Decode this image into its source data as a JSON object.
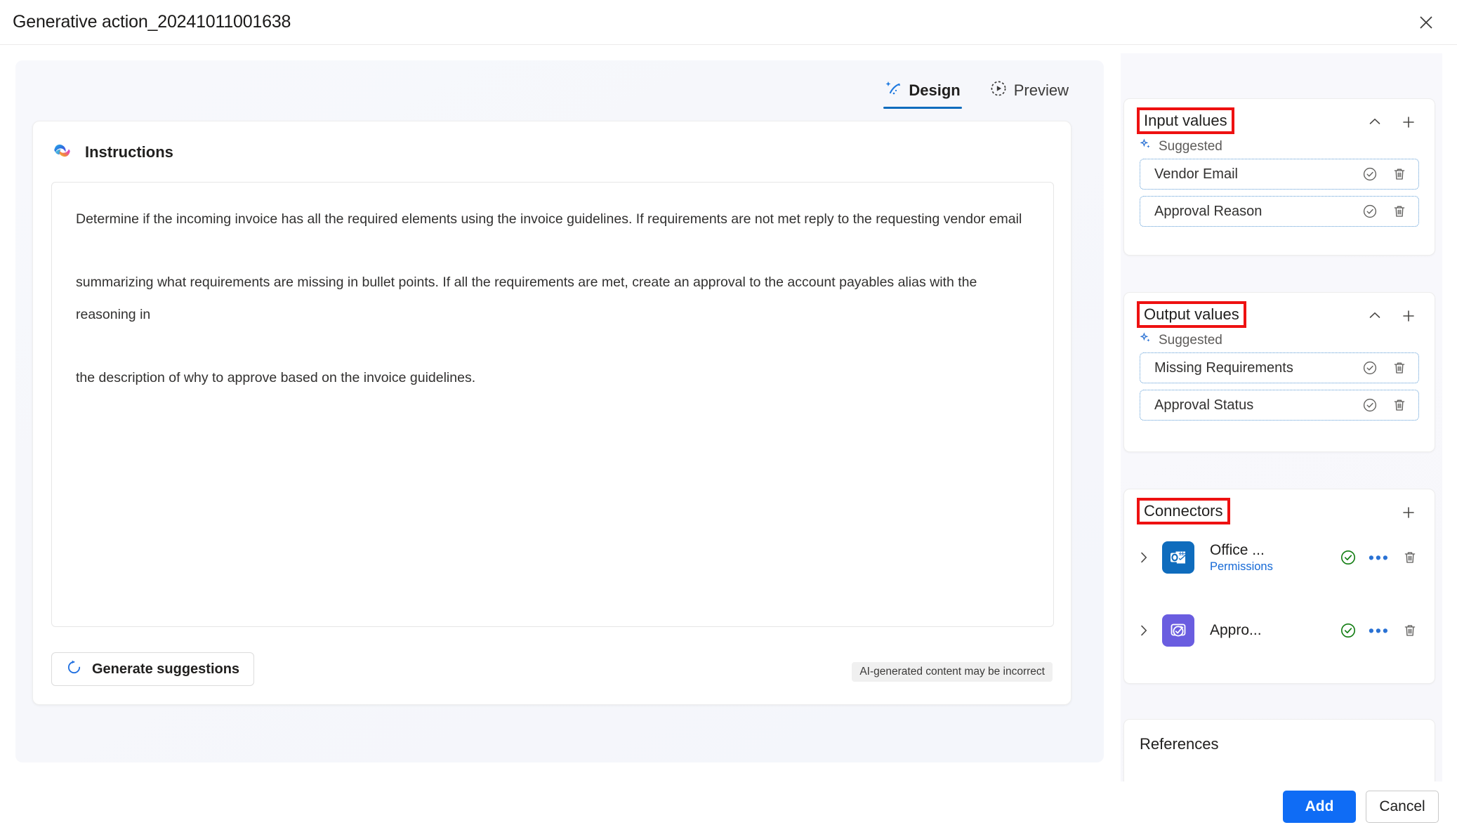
{
  "window": {
    "title": "Generative action_20241011001638",
    "close_icon": "close-icon"
  },
  "tabs": [
    {
      "label": "Design",
      "icon": "sparkle-wand-icon",
      "active": true
    },
    {
      "label": "Preview",
      "icon": "play-circle-dashed-icon",
      "active": false
    }
  ],
  "instructions": {
    "header": "Instructions",
    "header_icon": "copilot-icon",
    "text": "Determine if the incoming invoice has all the required elements using the invoice guidelines. If requirements are not met reply to the requesting vendor email\n\nsummarizing what requirements are missing in bullet points. If all the requirements are met, create an approval to the account payables alias with the reasoning in\n\nthe description of why to approve based on the invoice guidelines.",
    "generate_button": "Generate suggestions",
    "generate_icon": "refresh-circle-icon",
    "ai_disclaimer": "AI-generated content may be incorrect"
  },
  "panels": {
    "input_values": {
      "title": "Input values",
      "annotated": true,
      "collapse_icon": "chevron-up-icon",
      "add_icon": "plus-icon",
      "suggested_label": "Suggested",
      "suggested_icon": "sparkle-icon",
      "items": [
        {
          "name": "Vendor Email",
          "accept_icon": "check-circle-icon",
          "delete_icon": "trash-icon"
        },
        {
          "name": "Approval Reason",
          "accept_icon": "check-circle-icon",
          "delete_icon": "trash-icon"
        }
      ]
    },
    "output_values": {
      "title": "Output values",
      "annotated": true,
      "collapse_icon": "chevron-up-icon",
      "add_icon": "plus-icon",
      "suggested_label": "Suggested",
      "suggested_icon": "sparkle-icon",
      "items": [
        {
          "name": "Missing Requirements",
          "accept_icon": "check-circle-icon",
          "delete_icon": "trash-icon"
        },
        {
          "name": "Approval Status",
          "accept_icon": "check-circle-icon",
          "delete_icon": "trash-icon"
        }
      ]
    },
    "connectors": {
      "title": "Connectors",
      "annotated": true,
      "add_icon": "plus-icon",
      "items": [
        {
          "name": "Office ...",
          "sublabel": "Permissions",
          "icon": "outlook-icon",
          "status_icon": "check-circle-green-icon",
          "more_icon": "more-horizontal-icon",
          "delete_icon": "trash-icon",
          "expand_icon": "chevron-right-icon"
        },
        {
          "name": "Appro...",
          "sublabel": "",
          "icon": "approvals-icon",
          "status_icon": "check-circle-green-icon",
          "more_icon": "more-horizontal-icon",
          "delete_icon": "trash-icon",
          "expand_icon": "chevron-right-icon"
        }
      ]
    },
    "references": {
      "title": "References"
    }
  },
  "footer": {
    "primary_button": "Add",
    "secondary_button": "Cancel"
  },
  "colors": {
    "accent_blue": "#0f6cf5",
    "tab_underline": "#0f6cbd",
    "annotation_red": "#ee1111",
    "suggested_border": "#5b9bd5",
    "status_green": "#107c10",
    "link_blue": "#1569d6",
    "outlook_tile": "#0f6cbd",
    "approvals_tile": "#6a5de0"
  }
}
